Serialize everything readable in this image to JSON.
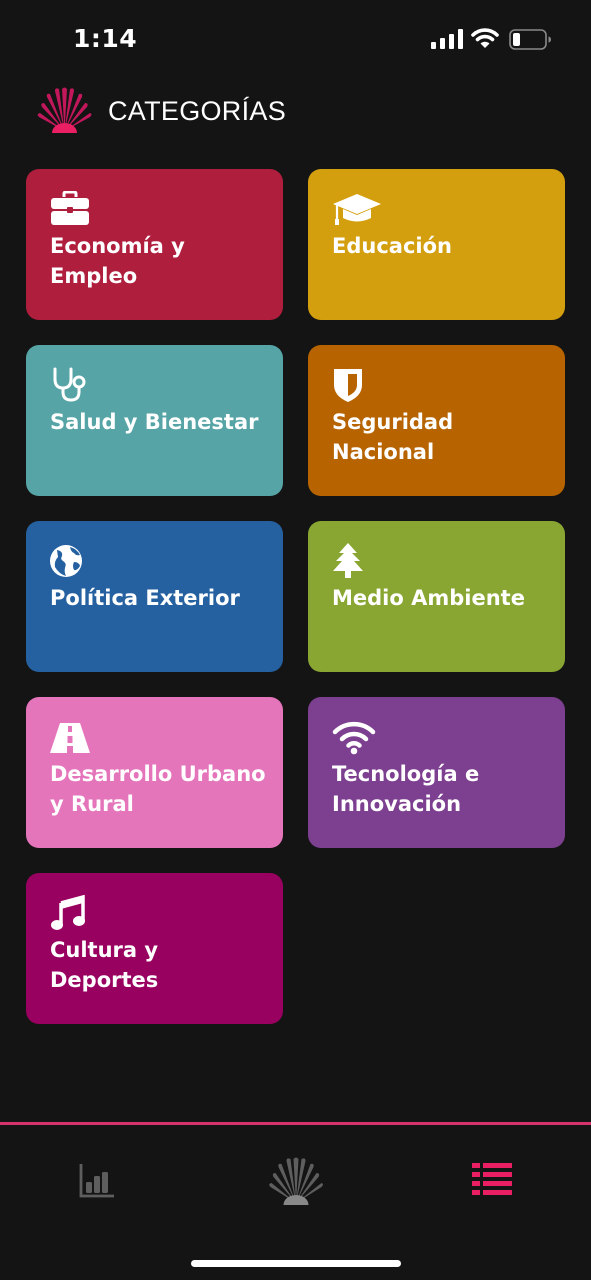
{
  "status": {
    "time": "1:14"
  },
  "header": {
    "title": "CATEGORÍAS",
    "logo_icon": "fan-shell-logo-icon"
  },
  "colors": {
    "background": "#141414",
    "accent": "#d6336c"
  },
  "categories": [
    {
      "label": "Economía y Empleo",
      "icon": "briefcase-icon",
      "color": "#b01e3e"
    },
    {
      "label": "Educación",
      "icon": "graduation-cap-icon",
      "color": "#d49f0e"
    },
    {
      "label": "Salud y Bienestar",
      "icon": "stethoscope-icon",
      "color": "#56a4a6"
    },
    {
      "label": "Seguridad Nacional",
      "icon": "shield-icon",
      "color": "#b66300"
    },
    {
      "label": "Política Exterior",
      "icon": "globe-icon",
      "color": "#2561a0"
    },
    {
      "label": "Medio Ambiente",
      "icon": "tree-icon",
      "color": "#89a632"
    },
    {
      "label": "Desarrollo Urbano y Rural",
      "icon": "road-icon",
      "color": "#e575bb"
    },
    {
      "label": "Tecnología e Innovación",
      "icon": "wifi-icon",
      "color": "#7d3f90"
    },
    {
      "label": "Cultura y Deportes",
      "icon": "music-note-icon",
      "color": "#990161"
    }
  ],
  "bottom_nav": [
    {
      "icon": "bar-chart-icon",
      "active": false
    },
    {
      "icon": "fan-shell-logo-icon",
      "active": false
    },
    {
      "icon": "list-icon",
      "active": true
    }
  ]
}
